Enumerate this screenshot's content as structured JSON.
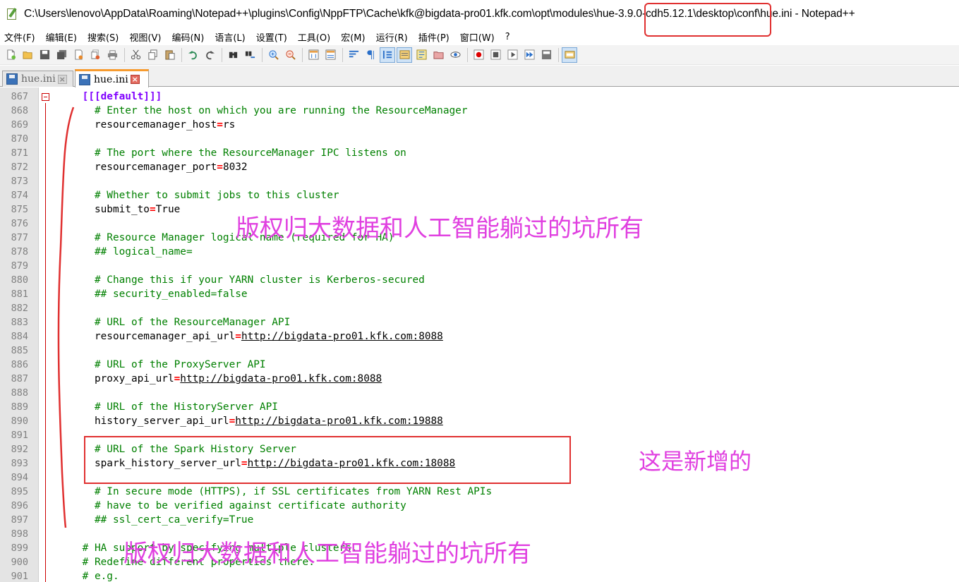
{
  "window": {
    "title": "C:\\Users\\lenovo\\AppData\\Roaming\\Notepad++\\plugins\\Config\\NppFTP\\Cache\\kfk@bigdata-pro01.kfk.com\\opt\\modules\\hue-3.9.0-cdh5.12.1\\desktop\\conf\\hue.ini - Notepad++"
  },
  "menu": [
    "文件(F)",
    "编辑(E)",
    "搜索(S)",
    "视图(V)",
    "编码(N)",
    "语言(L)",
    "设置(T)",
    "工具(O)",
    "宏(M)",
    "运行(R)",
    "插件(P)",
    "窗口(W)",
    "?"
  ],
  "toolbar": {
    "icons": [
      "new-file-icon",
      "open-file-icon",
      "save-icon",
      "save-all-icon",
      "close-icon",
      "close-all-icon",
      "print-icon",
      "cut-icon",
      "copy-icon",
      "paste-icon",
      "undo-icon",
      "redo-icon",
      "find-icon",
      "replace-icon",
      "zoom-in-icon",
      "zoom-out-icon",
      "sync-vertical-icon",
      "sync-horizontal-icon",
      "word-wrap-icon",
      "show-all-chars-icon",
      "indent-guide-icon",
      "doc-map-icon",
      "function-list-icon",
      "folder-workspace-icon",
      "monitoring-icon",
      "record-macro-icon",
      "stop-record-icon",
      "play-macro-icon",
      "run-macro-multiple-icon",
      "save-macro-icon",
      "nppftp-icon"
    ]
  },
  "tabs": [
    {
      "label": "hue.ini",
      "active": false
    },
    {
      "label": "hue.ini",
      "active": true
    }
  ],
  "editor": {
    "lines": [
      {
        "no": "867",
        "parts": [
          {
            "t": "    [[[default]]]",
            "k": "section"
          }
        ]
      },
      {
        "no": "868",
        "parts": [
          {
            "t": "      # Enter the host on which you are running the ResourceManager",
            "k": "comment"
          }
        ]
      },
      {
        "no": "869",
        "parts": [
          {
            "t": "      resourcemanager_host",
            "k": "key"
          },
          {
            "t": "=",
            "k": "op"
          },
          {
            "t": "rs",
            "k": "key"
          }
        ]
      },
      {
        "no": "870",
        "parts": []
      },
      {
        "no": "871",
        "parts": [
          {
            "t": "      # The port where the ResourceManager IPC listens on",
            "k": "comment"
          }
        ]
      },
      {
        "no": "872",
        "parts": [
          {
            "t": "      resourcemanager_port",
            "k": "key"
          },
          {
            "t": "=",
            "k": "op"
          },
          {
            "t": "8032",
            "k": "key"
          }
        ]
      },
      {
        "no": "873",
        "parts": []
      },
      {
        "no": "874",
        "parts": [
          {
            "t": "      # Whether to submit jobs to this cluster",
            "k": "comment"
          }
        ]
      },
      {
        "no": "875",
        "parts": [
          {
            "t": "      submit_to",
            "k": "key"
          },
          {
            "t": "=",
            "k": "op"
          },
          {
            "t": "True",
            "k": "key"
          }
        ]
      },
      {
        "no": "876",
        "parts": []
      },
      {
        "no": "877",
        "parts": [
          {
            "t": "      # Resource Manager logical name (required for HA)",
            "k": "comment"
          }
        ]
      },
      {
        "no": "878",
        "parts": [
          {
            "t": "      ## logical_name=",
            "k": "comment"
          }
        ]
      },
      {
        "no": "879",
        "parts": []
      },
      {
        "no": "880",
        "parts": [
          {
            "t": "      # Change this if your YARN cluster is Kerberos-secured",
            "k": "comment"
          }
        ]
      },
      {
        "no": "881",
        "parts": [
          {
            "t": "      ## security_enabled=false",
            "k": "comment"
          }
        ]
      },
      {
        "no": "882",
        "parts": []
      },
      {
        "no": "883",
        "parts": [
          {
            "t": "      # URL of the ResourceManager API",
            "k": "comment"
          }
        ]
      },
      {
        "no": "884",
        "parts": [
          {
            "t": "      resourcemanager_api_url",
            "k": "key"
          },
          {
            "t": "=",
            "k": "op"
          },
          {
            "t": "http://bigdata-pro01.kfk.com:8088",
            "k": "url"
          }
        ]
      },
      {
        "no": "885",
        "parts": []
      },
      {
        "no": "886",
        "parts": [
          {
            "t": "      # URL of the ProxyServer API",
            "k": "comment"
          }
        ]
      },
      {
        "no": "887",
        "parts": [
          {
            "t": "      proxy_api_url",
            "k": "key"
          },
          {
            "t": "=",
            "k": "op"
          },
          {
            "t": "http://bigdata-pro01.kfk.com:8088",
            "k": "url"
          }
        ]
      },
      {
        "no": "888",
        "parts": []
      },
      {
        "no": "889",
        "parts": [
          {
            "t": "      # URL of the HistoryServer API",
            "k": "comment"
          }
        ]
      },
      {
        "no": "890",
        "parts": [
          {
            "t": "      history_server_api_url",
            "k": "key"
          },
          {
            "t": "=",
            "k": "op"
          },
          {
            "t": "http://bigdata-pro01.kfk.com:19888",
            "k": "url"
          }
        ]
      },
      {
        "no": "891",
        "parts": []
      },
      {
        "no": "892",
        "parts": [
          {
            "t": "      # URL of the Spark History Server",
            "k": "comment"
          }
        ]
      },
      {
        "no": "893",
        "parts": [
          {
            "t": "      spark_history_server_url",
            "k": "key"
          },
          {
            "t": "=",
            "k": "op"
          },
          {
            "t": "http://bigdata-pro01.kfk.com:18088",
            "k": "url"
          }
        ]
      },
      {
        "no": "894",
        "parts": []
      },
      {
        "no": "895",
        "parts": [
          {
            "t": "      # In secure mode (HTTPS), if SSL certificates from YARN Rest APIs",
            "k": "comment"
          }
        ]
      },
      {
        "no": "896",
        "parts": [
          {
            "t": "      # have to be verified against certificate authority",
            "k": "comment"
          }
        ]
      },
      {
        "no": "897",
        "parts": [
          {
            "t": "      ## ssl_cert_ca_verify=True",
            "k": "comment"
          }
        ]
      },
      {
        "no": "898",
        "parts": []
      },
      {
        "no": "899",
        "parts": [
          {
            "t": "    # HA support by specifying multiple clusters.",
            "k": "comment"
          }
        ]
      },
      {
        "no": "900",
        "parts": [
          {
            "t": "    # Redefine different properties there.",
            "k": "comment"
          }
        ]
      },
      {
        "no": "901",
        "parts": [
          {
            "t": "    # e.g.",
            "k": "comment"
          }
        ]
      }
    ]
  },
  "annotations": {
    "watermark_1": "版权归大数据和人工智能躺过的坑所有",
    "watermark_2": "版权归大数据和人工智能躺过的坑所有",
    "new_note": "这是新增的",
    "color": "#e03030",
    "watermark_color": "#e040e0"
  }
}
